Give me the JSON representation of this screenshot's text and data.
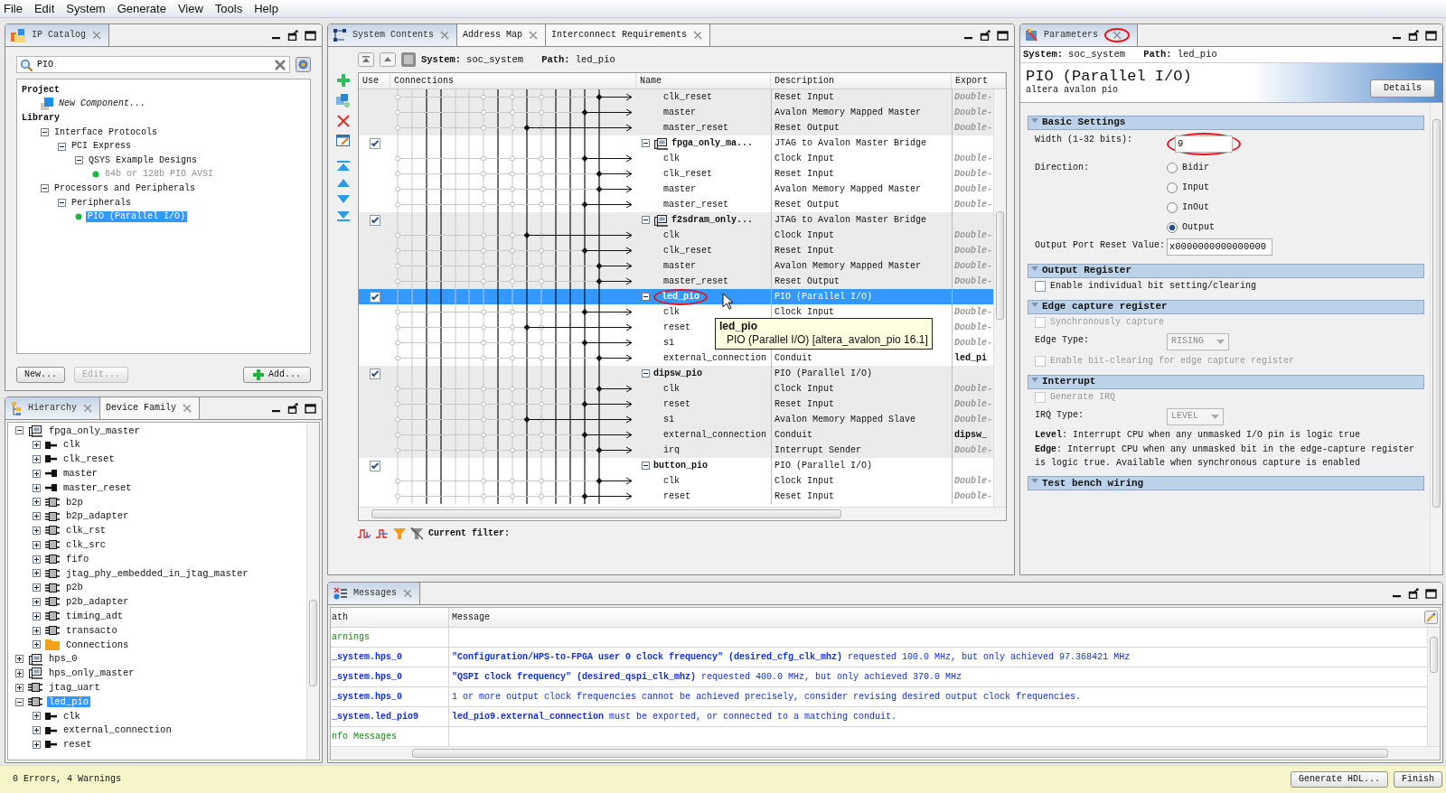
{
  "menu": [
    "File",
    "Edit",
    "System",
    "Generate",
    "View",
    "Tools",
    "Help"
  ],
  "ip_catalog": {
    "tabs": [
      {
        "label": "IP Catalog",
        "selected": true
      }
    ],
    "search": {
      "value": "PIO"
    },
    "tree": [
      {
        "label": "Project",
        "kind": "heading",
        "children": [
          {
            "label": "New Component...",
            "kind": "new-component",
            "selected": false
          }
        ]
      },
      {
        "label": "Library",
        "kind": "heading",
        "children": [
          {
            "label": "Interface Protocols",
            "kind": "category",
            "expanded": true,
            "selected": false,
            "children": [
              {
                "label": "PCI Express",
                "kind": "category",
                "expanded": true,
                "selected": false,
                "children": [
                  {
                    "label": "QSYS Example Designs",
                    "kind": "category",
                    "expanded": true,
                    "selected": false,
                    "children": [
                      {
                        "label": "64b or 128b PIO AVSI",
                        "kind": "ip",
                        "selected": false,
                        "disabled": true
                      }
                    ]
                  }
                ]
              }
            ]
          },
          {
            "label": "Processors and Peripherals",
            "kind": "category",
            "expanded": true,
            "selected": false,
            "children": [
              {
                "label": "Peripherals",
                "kind": "category",
                "expanded": true,
                "selected": false,
                "children": [
                  {
                    "label": "PIO (Parallel I/O)",
                    "kind": "ip",
                    "selected": true,
                    "disabled": false
                  }
                ]
              }
            ]
          }
        ]
      }
    ],
    "buttons": [
      {
        "label": "New...",
        "kind": "plain",
        "disabled": false
      },
      {
        "label": "Edit...",
        "kind": "plain",
        "disabled": true
      },
      {
        "label": "Add...",
        "kind": "add",
        "disabled": false
      }
    ]
  },
  "hierarchy": {
    "tabs": [
      {
        "label": "Hierarchy",
        "selected": true
      },
      {
        "label": "Device Family",
        "selected": false
      }
    ],
    "tree": [
      {
        "label": "fpga_only_master",
        "kind": "system",
        "expanded": true,
        "selected": false,
        "children": [
          {
            "label": "clk",
            "kind": "port-in",
            "expanded": false,
            "selected": false
          },
          {
            "label": "clk_reset",
            "kind": "port-in",
            "expanded": false,
            "selected": false
          },
          {
            "label": "master",
            "kind": "port-out",
            "expanded": false,
            "selected": false
          },
          {
            "label": "master_reset",
            "kind": "port-out",
            "expanded": false,
            "selected": false
          },
          {
            "label": "b2p",
            "kind": "module",
            "expanded": false,
            "selected": false
          },
          {
            "label": "b2p_adapter",
            "kind": "module",
            "expanded": false,
            "selected": false
          },
          {
            "label": "clk_rst",
            "kind": "module",
            "expanded": false,
            "selected": false
          },
          {
            "label": "clk_src",
            "kind": "module",
            "expanded": false,
            "selected": false
          },
          {
            "label": "fifo",
            "kind": "module",
            "expanded": false,
            "selected": false
          },
          {
            "label": "jtag_phy_embedded_in_jtag_master",
            "kind": "module",
            "expanded": false,
            "selected": false
          },
          {
            "label": "p2b",
            "kind": "module",
            "expanded": false,
            "selected": false
          },
          {
            "label": "p2b_adapter",
            "kind": "module",
            "expanded": false,
            "selected": false
          },
          {
            "label": "timing_adt",
            "kind": "module",
            "expanded": false,
            "selected": false
          },
          {
            "label": "transacto",
            "kind": "module",
            "expanded": false,
            "selected": false
          },
          {
            "label": "Connections",
            "kind": "folder",
            "expanded": false,
            "selected": false
          }
        ]
      },
      {
        "label": "hps_0",
        "kind": "system",
        "expanded": false,
        "selected": false
      },
      {
        "label": "hps_only_master",
        "kind": "system",
        "expanded": false,
        "selected": false
      },
      {
        "label": "jtag_uart",
        "kind": "module",
        "expanded": false,
        "selected": false
      },
      {
        "label": "led_pio",
        "kind": "module",
        "expanded": true,
        "selected": true,
        "children": [
          {
            "label": "clk",
            "kind": "port-in",
            "expanded": false,
            "selected": false
          },
          {
            "label": "external_connection",
            "kind": "port-in",
            "expanded": false,
            "selected": false
          },
          {
            "label": "reset",
            "kind": "port-in",
            "expanded": false,
            "selected": false
          }
        ]
      }
    ]
  },
  "system_contents": {
    "tabs": [
      {
        "label": "System Contents",
        "selected": true
      },
      {
        "label": "Address Map",
        "selected": false
      },
      {
        "label": "Interconnect Requirements",
        "selected": false
      }
    ],
    "system_label": "System:",
    "system": "soc_system",
    "path_label": "Path:",
    "path": "led_pio",
    "columns": [
      "Use",
      "Connections",
      "Name",
      "Description",
      "Export"
    ],
    "rows": [
      {
        "kind": "port",
        "name": "clk_reset",
        "description": "Reset Input",
        "export": "Double-",
        "exported": false
      },
      {
        "kind": "port",
        "name": "master",
        "description": "Avalon Memory Mapped Master",
        "export": "Double-",
        "exported": false
      },
      {
        "kind": "port",
        "name": "master_reset",
        "description": "Reset Output",
        "export": "Double-",
        "exported": false
      },
      {
        "kind": "bridge",
        "name": "fpga_only_ma...",
        "description": "JTAG to Avalon Master Bridge",
        "use": true,
        "expanded": true,
        "selected": false
      },
      {
        "kind": "port",
        "name": "clk",
        "description": "Clock Input",
        "export": "Double-",
        "exported": false
      },
      {
        "kind": "port",
        "name": "clk_reset",
        "description": "Reset Input",
        "export": "Double-",
        "exported": false
      },
      {
        "kind": "port",
        "name": "master",
        "description": "Avalon Memory Mapped Master",
        "export": "Double-",
        "exported": false
      },
      {
        "kind": "port",
        "name": "master_reset",
        "description": "Reset Output",
        "export": "Double-",
        "exported": false
      },
      {
        "kind": "bridge",
        "name": "f2sdram_only...",
        "description": "JTAG to Avalon Master Bridge",
        "use": true,
        "expanded": true,
        "selected": false
      },
      {
        "kind": "port",
        "name": "clk",
        "description": "Clock Input",
        "export": "Double-",
        "exported": false
      },
      {
        "kind": "port",
        "name": "clk_reset",
        "description": "Reset Input",
        "export": "Double-",
        "exported": false
      },
      {
        "kind": "port",
        "name": "master",
        "description": "Avalon Memory Mapped Master",
        "export": "Double-",
        "exported": false
      },
      {
        "kind": "port",
        "name": "master_reset",
        "description": "Reset Output",
        "export": "Double-",
        "exported": false
      },
      {
        "kind": "pio",
        "name": "led_pio",
        "description": "PIO (Parallel I/O)",
        "use": true,
        "expanded": true,
        "selected": true,
        "circled": true
      },
      {
        "kind": "port",
        "name": "clk",
        "description": "Clock Input",
        "export": "Double-",
        "exported": false
      },
      {
        "kind": "port",
        "name": "reset",
        "export": "Double-",
        "exported": false
      },
      {
        "kind": "port",
        "name": "s1",
        "export": "Double-",
        "exported": false
      },
      {
        "kind": "port",
        "name": "external_connection",
        "description": "Conduit",
        "export": "led_pi",
        "exported": true
      },
      {
        "kind": "pio",
        "name": "dipsw_pio",
        "description": "PIO (Parallel I/O)",
        "use": true,
        "expanded": true,
        "selected": false
      },
      {
        "kind": "port",
        "name": "clk",
        "description": "Clock Input",
        "export": "Double-",
        "exported": false
      },
      {
        "kind": "port",
        "name": "reset",
        "description": "Reset Input",
        "export": "Double-",
        "exported": false
      },
      {
        "kind": "port",
        "name": "s1",
        "description": "Avalon Memory Mapped Slave",
        "export": "Double-",
        "exported": false
      },
      {
        "kind": "port",
        "name": "external_connection",
        "description": "Conduit",
        "export": "dipsw_",
        "exported": true
      },
      {
        "kind": "port",
        "name": "irq",
        "description": "Interrupt Sender",
        "export": "Double-",
        "exported": false
      },
      {
        "kind": "pio",
        "name": "button_pio",
        "description": "PIO (Parallel I/O)",
        "use": true,
        "expanded": true,
        "selected": false
      },
      {
        "kind": "port",
        "name": "clk",
        "description": "Clock Input",
        "export": "Double-",
        "exported": false
      },
      {
        "kind": "port",
        "name": "reset",
        "description": "Reset Input",
        "export": "Double-",
        "exported": false
      }
    ],
    "tooltip": {
      "title": "led_pio",
      "text": "PIO (Parallel I/O) [altera_avalon_pio 16.1]"
    },
    "filter_label": "Current filter:"
  },
  "parameters": {
    "tabs": [
      {
        "label": "Parameters",
        "selected": true,
        "circled": true
      }
    ],
    "system_label": "System:",
    "system": "soc_system",
    "path_label": "Path:",
    "path": "led_pio",
    "title": "PIO (Parallel I/O)",
    "subtitle": "altera avalon pio",
    "details_button": "Details",
    "sections": [
      {
        "title": "Basic Settings",
        "expanded": true,
        "fields": [
          {
            "kind": "text",
            "label": "Width (1-32 bits):",
            "value": "9",
            "circled": true
          },
          {
            "kind": "radio",
            "label": "Direction:",
            "options": [
              {
                "label": "Bidir",
                "selected": false
              },
              {
                "label": "Input",
                "selected": false
              },
              {
                "label": "InOut",
                "selected": false
              },
              {
                "label": "Output",
                "selected": true
              }
            ]
          },
          {
            "kind": "text",
            "label": "Output Port Reset Value:",
            "value": "x0000000000000000"
          }
        ]
      },
      {
        "title": "Output Register",
        "expanded": true,
        "fields": [
          {
            "kind": "checkbox",
            "label": "Enable individual bit setting/clearing",
            "checked": false,
            "disabled": false
          }
        ]
      },
      {
        "title": "Edge capture register",
        "expanded": true,
        "fields": [
          {
            "kind": "checkbox",
            "label": "Synchronously capture",
            "checked": false,
            "disabled": true
          },
          {
            "kind": "select",
            "label": "Edge Type:",
            "value": "RISING",
            "disabled": true
          },
          {
            "kind": "checkbox",
            "label": "Enable bit-clearing for edge capture register",
            "checked": false,
            "disabled": true
          }
        ]
      },
      {
        "title": "Interrupt",
        "expanded": true,
        "fields": [
          {
            "kind": "checkbox",
            "label": "Generate IRQ",
            "checked": false,
            "disabled": true
          },
          {
            "kind": "select",
            "label": "IRQ Type:",
            "value": "LEVEL",
            "disabled": true
          },
          {
            "kind": "note",
            "text": "**Level**: Interrupt CPU when any unmasked I/O pin is logic true"
          },
          {
            "kind": "note",
            "text": "**Edge**: Interrupt CPU when any unmasked bit in the edge-capture register is logic true. Available when synchronous capture is enabled"
          }
        ]
      },
      {
        "title": "Test bench wiring",
        "expanded": true
      }
    ]
  },
  "messages": {
    "tabs": [
      {
        "label": "Messages",
        "selected": true
      }
    ],
    "columns": [
      "ath",
      "Message"
    ],
    "rows": [
      {
        "kind": "group",
        "path": "arnings"
      },
      {
        "kind": "warning",
        "path": "_system.hps_0",
        "message": "**\"Configuration/HPS-to-FPGA user 0 clock frequency\" (desired_cfg_clk_mhz)** requested 100.0 MHz, but only achieved 97.368421 MHz"
      },
      {
        "kind": "warning",
        "path": "_system.hps_0",
        "message": "**\"QSPI clock frequency\" (desired_qspi_clk_mhz)** requested 400.0 MHz, but only achieved 370.0 MHz"
      },
      {
        "kind": "warning",
        "path": "_system.hps_0",
        "message": "1 or more output clock frequencies cannot be achieved precisely, consider revising desired output clock frequencies."
      },
      {
        "kind": "warning",
        "path": "_system.led_pio9",
        "message": "**led_pio9.external_connection** must be exported, or connected to a matching conduit."
      },
      {
        "kind": "group",
        "path": "nfo Messages"
      }
    ]
  },
  "status_bar": {
    "text": "0 Errors, 4 Warnings",
    "buttons": [
      "Generate HDL...",
      "Finish"
    ]
  }
}
